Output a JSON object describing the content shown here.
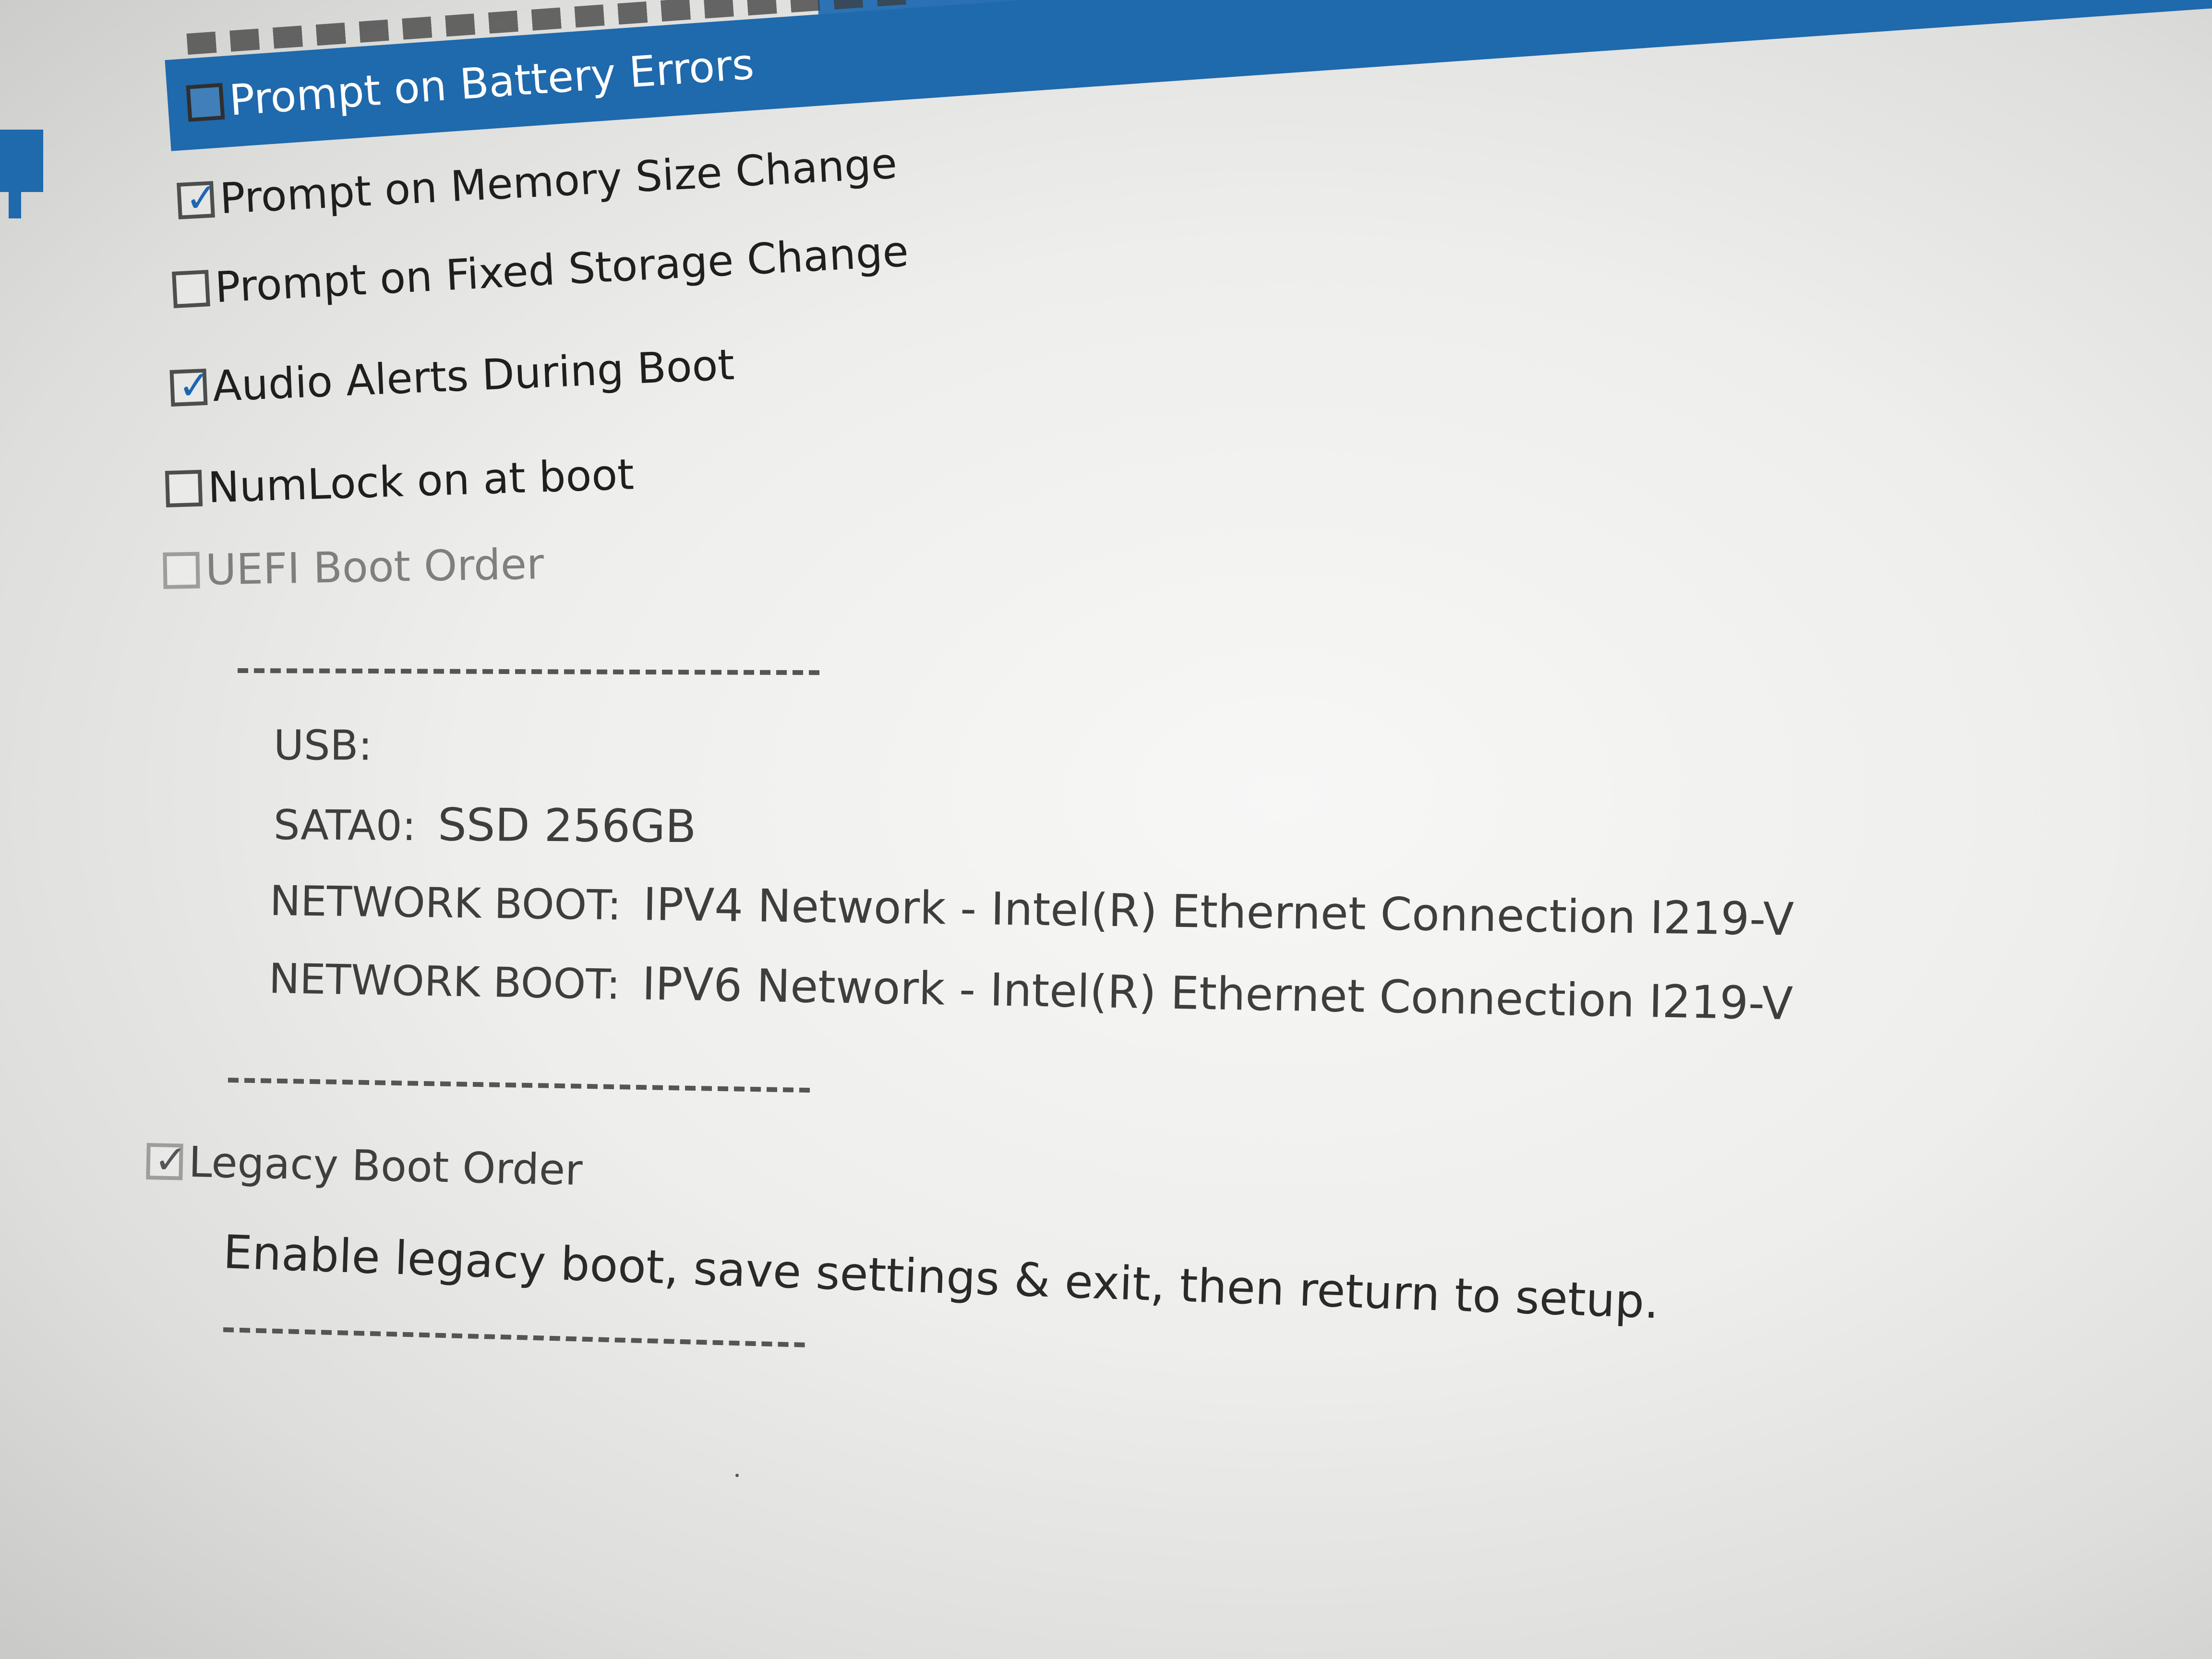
{
  "bios": {
    "options": [
      {
        "label": "Prompt on Battery Errors",
        "checked": false,
        "selected": true
      },
      {
        "label": "Prompt on Memory Size Change",
        "checked": true
      },
      {
        "label": "Prompt on Fixed Storage Change",
        "checked": false
      },
      {
        "label": "Audio Alerts During Boot",
        "checked": true
      },
      {
        "label": "NumLock on at boot",
        "checked": false
      },
      {
        "label": "UEFI Boot Order",
        "checked": false,
        "disabled": true
      },
      {
        "label": "Legacy Boot Order",
        "checked": true,
        "disabled": true
      }
    ],
    "boot_order": {
      "separator": "--------------------------",
      "usb_label": "USB:",
      "sata_prefix": "SATA0:",
      "sata_device": "SSD 256GB",
      "network_prefix": "NETWORK BOOT:",
      "network_ipv4": "IPV4 Network - Intel(R) Ethernet Connection I219-V",
      "network_ipv6": "IPV6 Network - Intel(R) Ethernet Connection I219-V"
    },
    "legacy_help": "Enable legacy boot, save settings & exit, then return to setup."
  },
  "colors": {
    "accent": "#1f69ad",
    "check": "#1f66b0",
    "text": "#1f1f1f",
    "muted": "#7f7f7f"
  },
  "icons": {
    "checkbox": "checkbox-icon",
    "checkmark": "checkmark-icon"
  }
}
